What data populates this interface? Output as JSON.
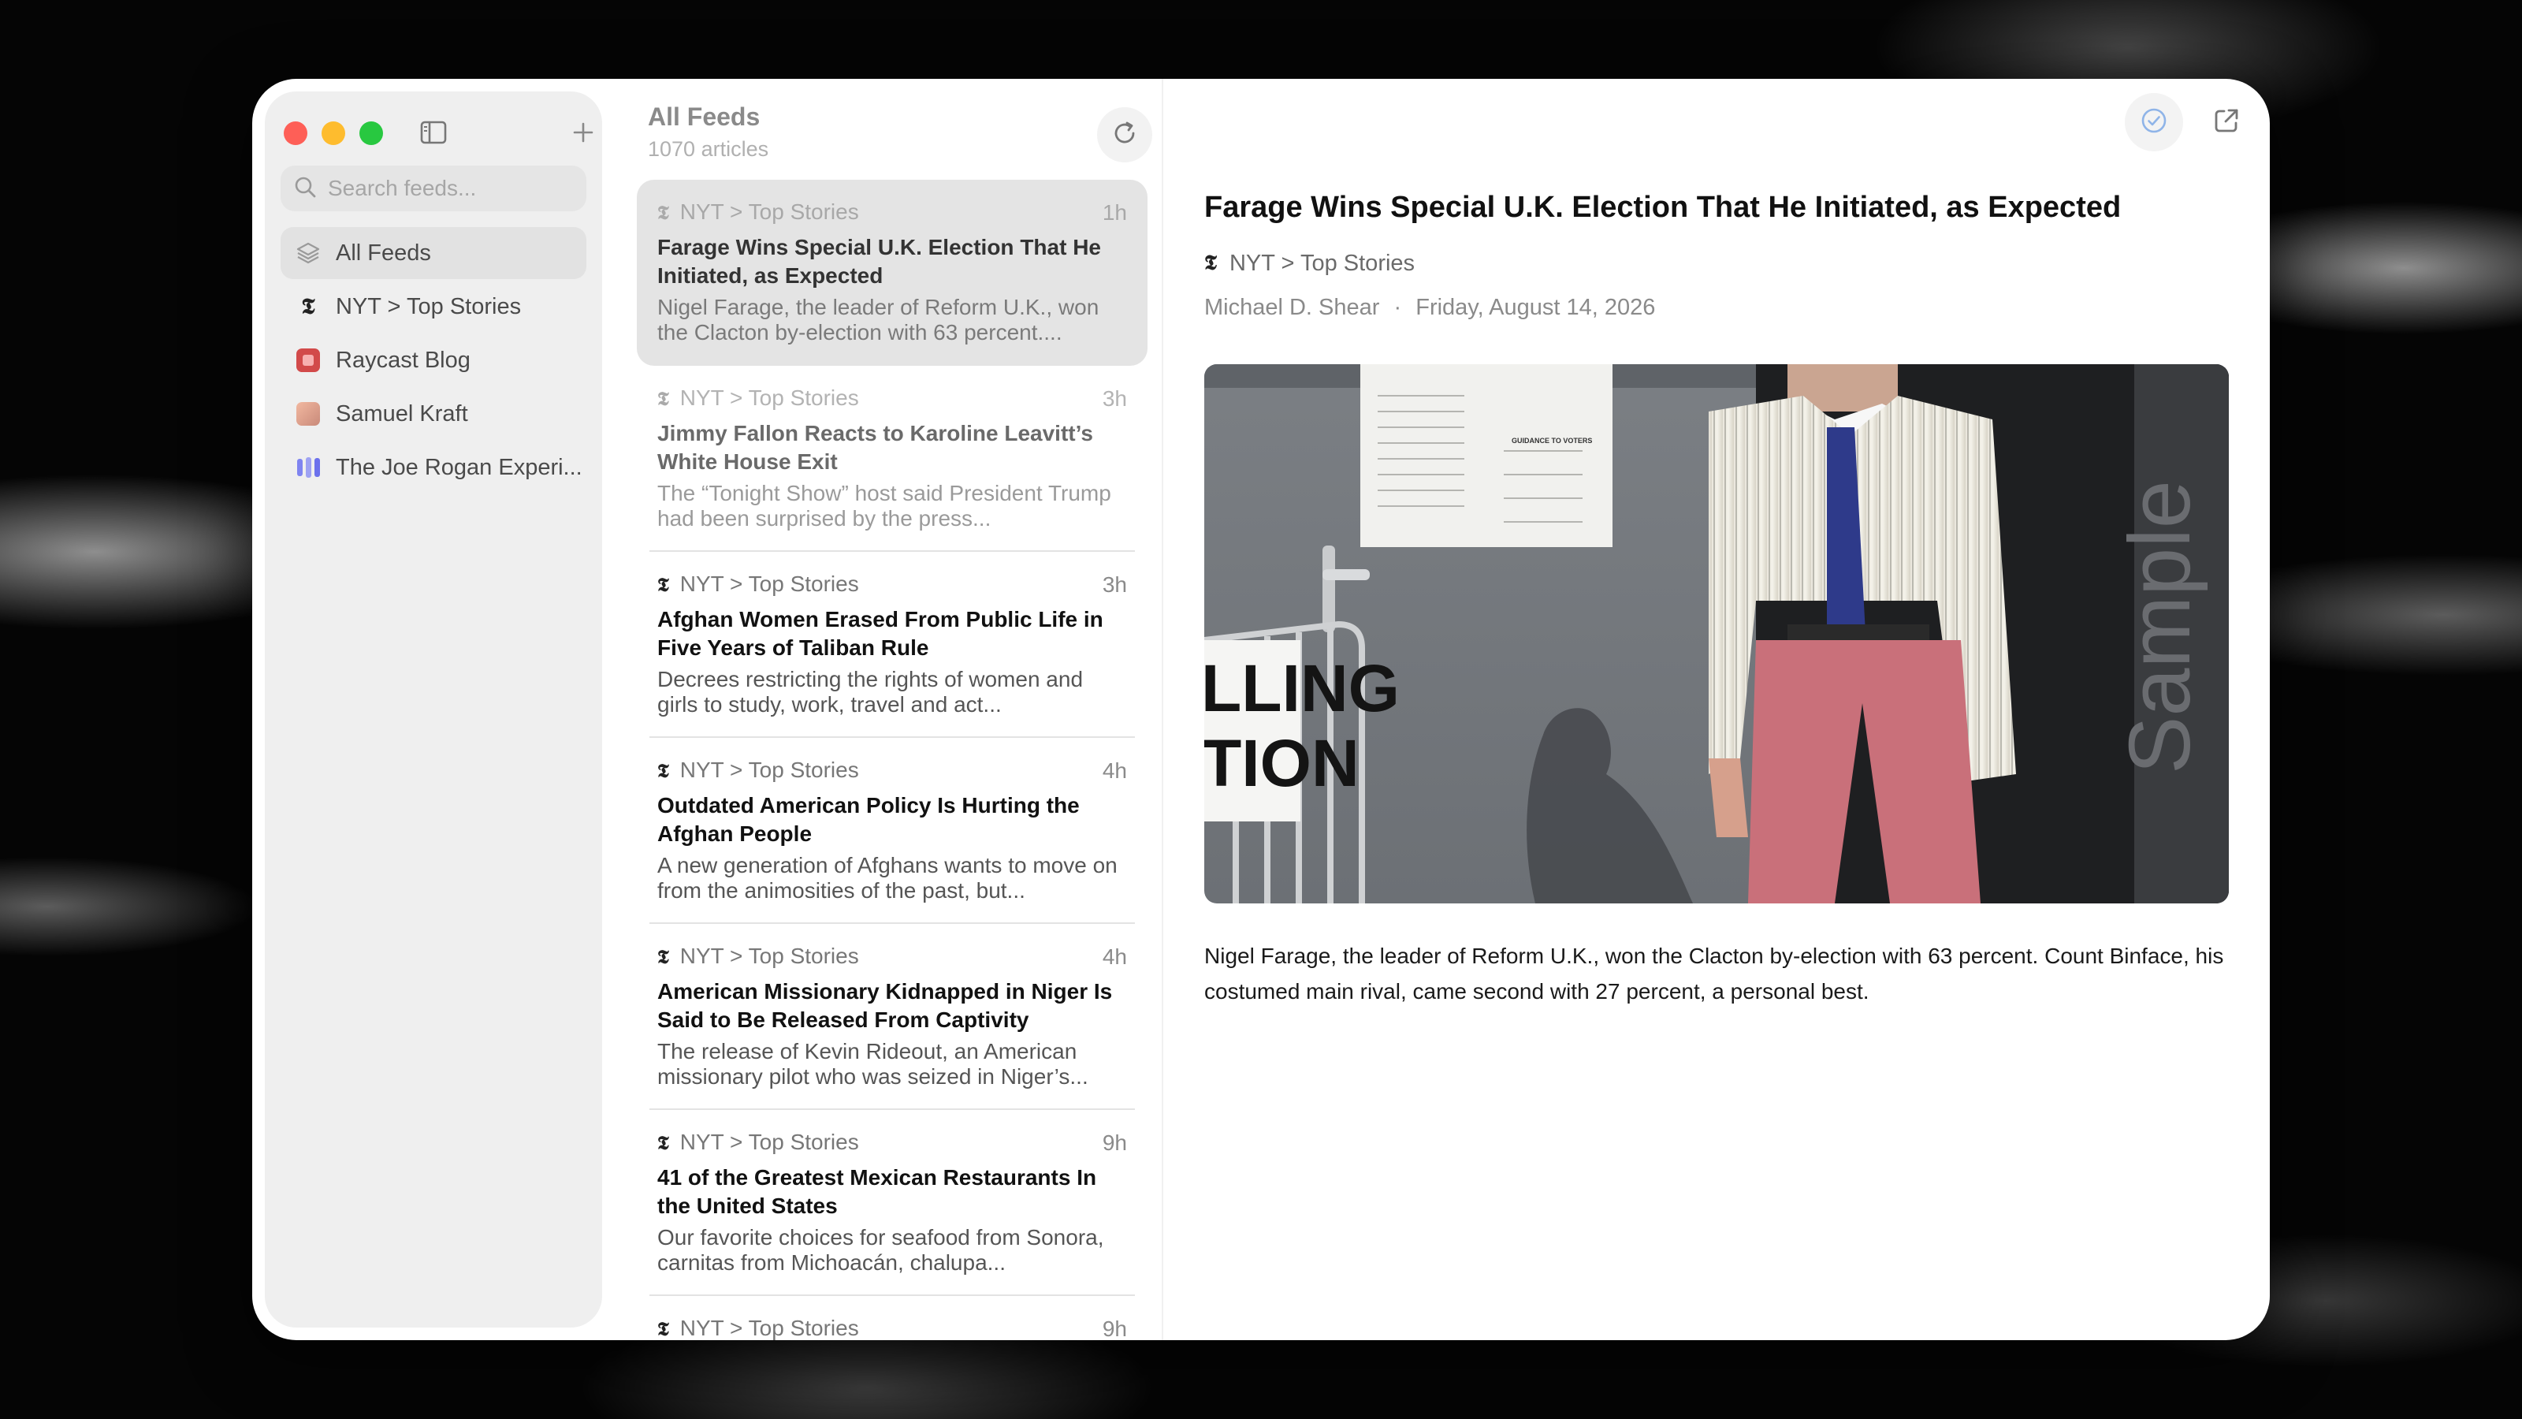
{
  "window": {
    "traffic_lights": [
      "close",
      "minimize",
      "zoom"
    ]
  },
  "sidebar": {
    "search_placeholder": "Search feeds...",
    "items": [
      {
        "label": "All Feeds",
        "icon": "layers-icon",
        "active": true
      },
      {
        "label": "NYT > Top Stories",
        "icon": "nyt-logo-icon"
      },
      {
        "label": "Raycast Blog",
        "icon": "raycast-logo-icon"
      },
      {
        "label": "Samuel Kraft",
        "icon": "avatar-icon"
      },
      {
        "label": "The Joe Rogan Experi...",
        "icon": "podcast-bars-icon"
      }
    ]
  },
  "list": {
    "title": "All Feeds",
    "count": "1070 articles",
    "articles": [
      {
        "source": "NYT > Top Stories",
        "time": "1h",
        "title": "Farage Wins Special U.K. Election That He Initiated, as Expected",
        "summary": "Nigel Farage, the leader of Reform U.K., won the Clacton by-election with 63 percent....",
        "state": "selected"
      },
      {
        "source": "NYT > Top Stories",
        "time": "3h",
        "title": "Jimmy Fallon Reacts to Karoline Leavitt’s White House Exit",
        "summary": "The “Tonight Show” host said President Trump had been surprised by the press...",
        "state": "read"
      },
      {
        "source": "NYT > Top Stories",
        "time": "3h",
        "title": "Afghan Women Erased From Public Life in Five Years of Taliban Rule",
        "summary": "Decrees restricting the rights of women and girls to study, work, travel and act...",
        "state": "unread"
      },
      {
        "source": "NYT > Top Stories",
        "time": "4h",
        "title": "Outdated American Policy Is Hurting the Afghan People",
        "summary": "A new generation of Afghans wants to move on from the animosities of the past, but...",
        "state": "unread"
      },
      {
        "source": "NYT > Top Stories",
        "time": "4h",
        "title": "American Missionary Kidnapped in Niger Is Said to Be Released From Captivity",
        "summary": "The release of Kevin Rideout, an American missionary pilot who was seized in Niger’s...",
        "state": "unread"
      },
      {
        "source": "NYT > Top Stories",
        "time": "9h",
        "title": "41 of the Greatest Mexican Restaurants In the United States",
        "summary": "Our favorite choices for seafood from Sonora, carnitas from Michoacán, chalupa...",
        "state": "unread"
      },
      {
        "source": "NYT > Top Stories",
        "time": "9h",
        "title": "",
        "summary": "",
        "state": "unread"
      }
    ]
  },
  "reader": {
    "title": "Farage Wins Special U.K. Election That He Initiated, as Expected",
    "source": "NYT > Top Stories",
    "author": "Michael D. Shear",
    "separator": "·",
    "date": "Friday, August 14, 2026",
    "image_sign_lines": [
      "LLING",
      "TION"
    ],
    "image_watermark": "Sample",
    "image_poster_text": "GUIDANCE TO VOTERS",
    "body": "Nigel Farage, the leader of Reform U.K., won the Clacton by-election with 63 percent. Count Binface, his costumed main rival, came second with 27 percent, a personal best."
  },
  "colors": {
    "accent_check": "#8fb4e8",
    "sidebar_bg": "#efefef",
    "selected_row": "#e4e4e4"
  }
}
